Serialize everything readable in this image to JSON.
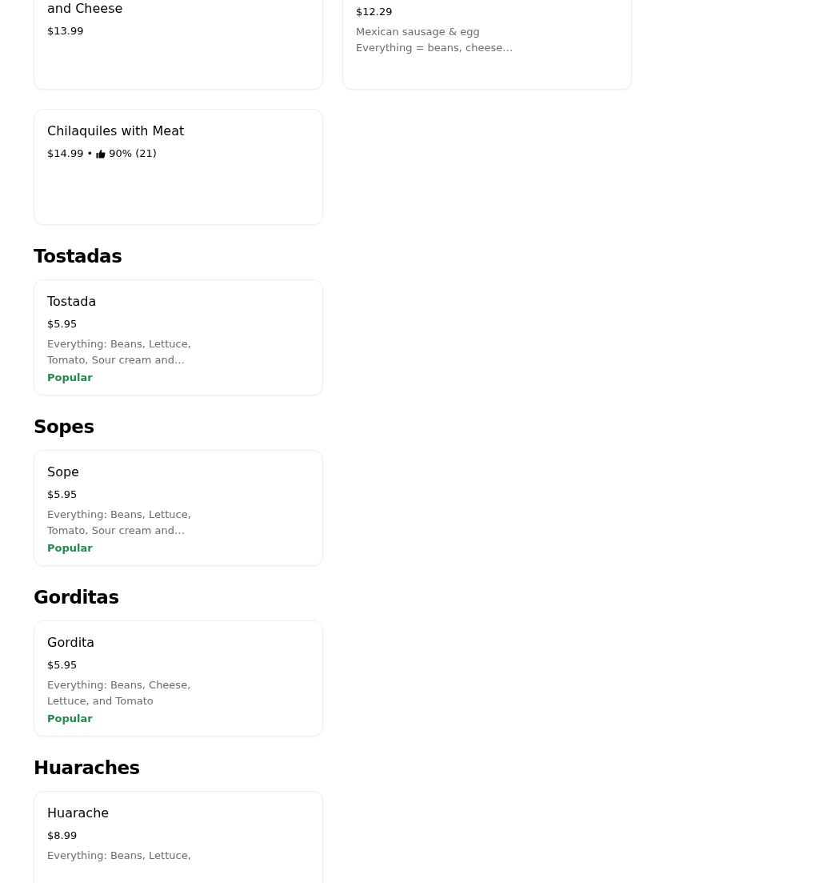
{
  "sections": [
    {
      "cut_top": true,
      "items": [
        {
          "title": "and Cheese",
          "price": "$13.99"
        },
        {
          "price": "$12.29",
          "description": "Mexican sausage & egg\nEverything = beans, cheese…"
        }
      ]
    },
    {
      "items": [
        {
          "title": "Chilaquiles with Meat",
          "price": "$14.99",
          "separator": "•",
          "rating": "90% (21)"
        }
      ]
    },
    {
      "heading": "Tostadas",
      "items": [
        {
          "title": "Tostada",
          "price": "$5.95",
          "description": "Everything: Beans, Lettuce, Tomato, Sour cream and…",
          "badge": "Popular"
        }
      ]
    },
    {
      "heading": "Sopes",
      "items": [
        {
          "title": "Sope",
          "price": "$5.95",
          "description": "Everything: Beans, Lettuce, Tomato, Sour cream and…",
          "badge": "Popular"
        }
      ]
    },
    {
      "heading": "Gorditas",
      "items": [
        {
          "title": "Gordita",
          "price": "$5.95",
          "description": "Everything: Beans, Cheese, Lettuce, and Tomato",
          "badge": "Popular"
        }
      ]
    },
    {
      "heading": "Huaraches",
      "items": [
        {
          "title": "Huarache",
          "price": "$8.99",
          "description": "Everything: Beans, Lettuce,"
        }
      ]
    }
  ]
}
